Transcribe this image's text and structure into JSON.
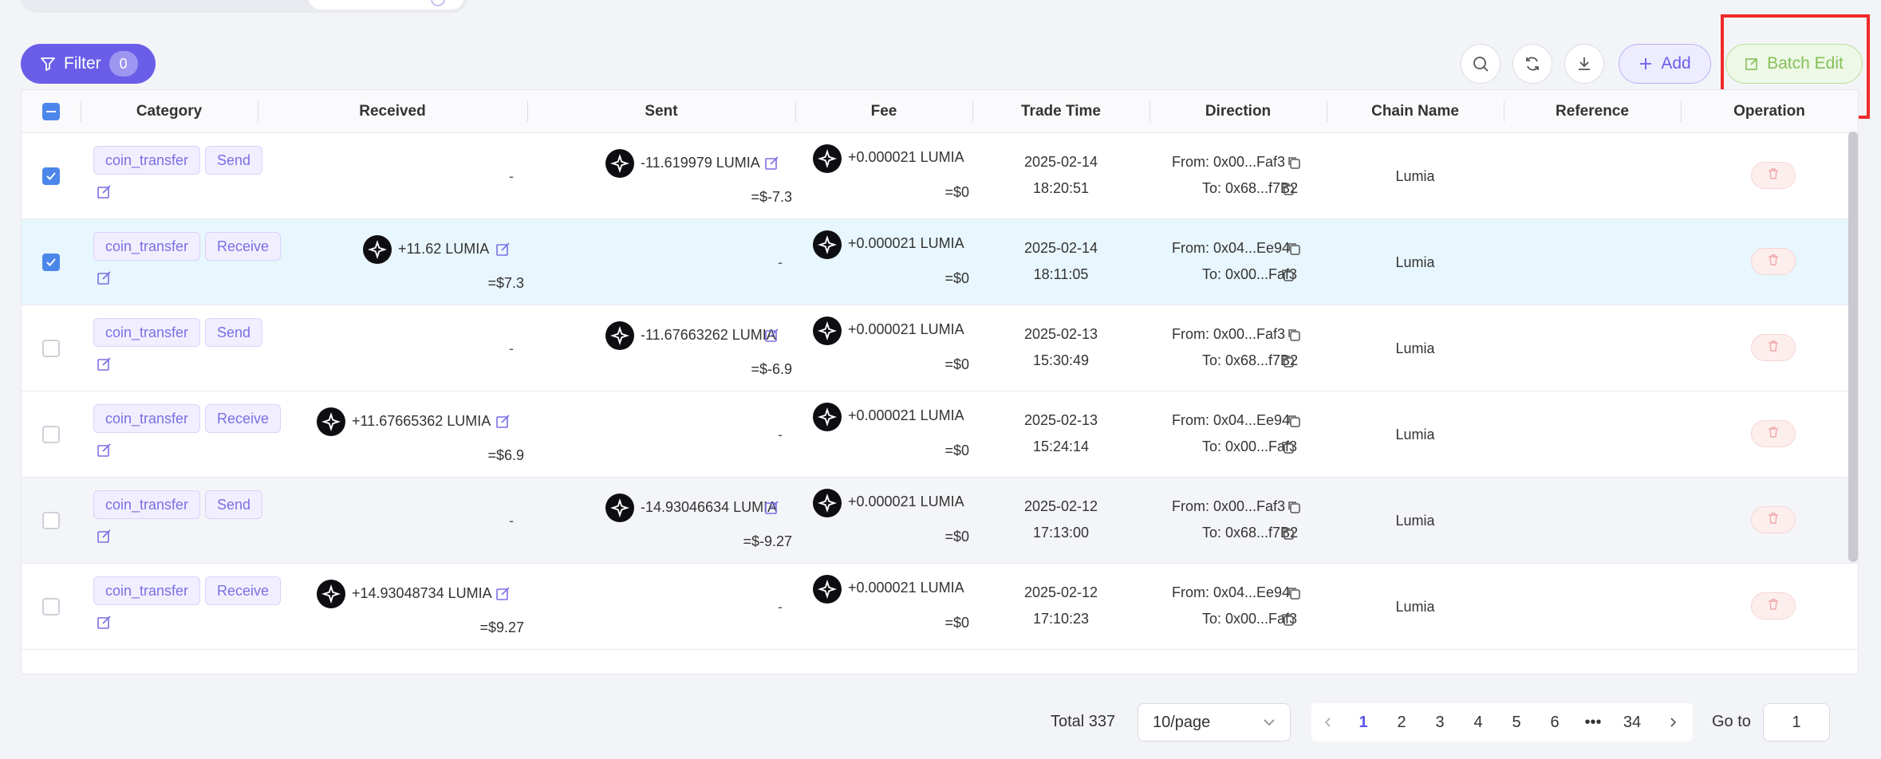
{
  "toolbar": {
    "filter_label": "Filter",
    "filter_count": "0",
    "add_label": "Add",
    "batch_edit_label": "Batch Edit",
    "icons": [
      "search-icon",
      "refresh-icon",
      "download-icon"
    ]
  },
  "columns": [
    "Category",
    "Received",
    "Sent",
    "Fee",
    "Trade Time",
    "Direction",
    "Chain Name",
    "Reference",
    "Operation"
  ],
  "rows": [
    {
      "checked": true,
      "tag1": "coin_transfer",
      "tag2": "Send",
      "received": "-",
      "received_usd": "",
      "sent": "-11.619979 LUMIA",
      "sent_usd": "=$-7.3",
      "fee": "+0.000021 LUMIA",
      "fee_usd": "=$0",
      "date": "2025-02-14",
      "time": "18:20:51",
      "from": "From: 0x00...Faf3",
      "to": "To: 0x68...f7B2",
      "chain": "Lumia",
      "style": "normal"
    },
    {
      "checked": true,
      "tag1": "coin_transfer",
      "tag2": "Receive",
      "received": "+11.62 LUMIA",
      "received_usd": "=$7.3",
      "sent": "-",
      "sent_usd": "",
      "fee": "+0.000021 LUMIA",
      "fee_usd": "=$0",
      "date": "2025-02-14",
      "time": "18:11:05",
      "from": "From: 0x04...Ee94",
      "to": "To: 0x00...Faf3",
      "chain": "Lumia",
      "style": "selected"
    },
    {
      "checked": false,
      "tag1": "coin_transfer",
      "tag2": "Send",
      "received": "-",
      "received_usd": "",
      "sent": "-11.67663262 LUMIA",
      "sent_usd": "=$-6.9",
      "fee": "+0.000021 LUMIA",
      "fee_usd": "=$0",
      "date": "2025-02-13",
      "time": "15:30:49",
      "from": "From: 0x00...Faf3",
      "to": "To: 0x68...f7B2",
      "chain": "Lumia",
      "style": "normal"
    },
    {
      "checked": false,
      "tag1": "coin_transfer",
      "tag2": "Receive",
      "received": "+11.67665362 LUMIA",
      "received_usd": "=$6.9",
      "sent": "-",
      "sent_usd": "",
      "fee": "+0.000021 LUMIA",
      "fee_usd": "=$0",
      "date": "2025-02-13",
      "time": "15:24:14",
      "from": "From: 0x04...Ee94",
      "to": "To: 0x00...Faf3",
      "chain": "Lumia",
      "style": "normal"
    },
    {
      "checked": false,
      "tag1": "coin_transfer",
      "tag2": "Send",
      "received": "-",
      "received_usd": "",
      "sent": "-14.93046634 LUMIA",
      "sent_usd": "=$-9.27",
      "fee": "+0.000021 LUMIA",
      "fee_usd": "=$0",
      "date": "2025-02-12",
      "time": "17:13:00",
      "from": "From: 0x00...Faf3",
      "to": "To: 0x68...f7B2",
      "chain": "Lumia",
      "style": "alt"
    },
    {
      "checked": false,
      "tag1": "coin_transfer",
      "tag2": "Receive",
      "received": "+14.93048734 LUMIA",
      "received_usd": "=$9.27",
      "sent": "-",
      "sent_usd": "",
      "fee": "+0.000021 LUMIA",
      "fee_usd": "=$0",
      "date": "2025-02-12",
      "time": "17:10:23",
      "from": "From: 0x04...Ee94",
      "to": "To: 0x00...Faf3",
      "chain": "Lumia",
      "style": "normal"
    }
  ],
  "pagination": {
    "total": "Total 337",
    "page_size": "10/page",
    "pages": [
      "1",
      "2",
      "3",
      "4",
      "5",
      "6",
      "•••",
      "34"
    ],
    "current": "1",
    "goto_label": "Go to",
    "goto_value": "1"
  },
  "colors": {
    "accent": "#6a5ee8",
    "batch": "#86c05a",
    "highlight": "#ef2a2a",
    "selected_row": "#e8f6fd"
  }
}
